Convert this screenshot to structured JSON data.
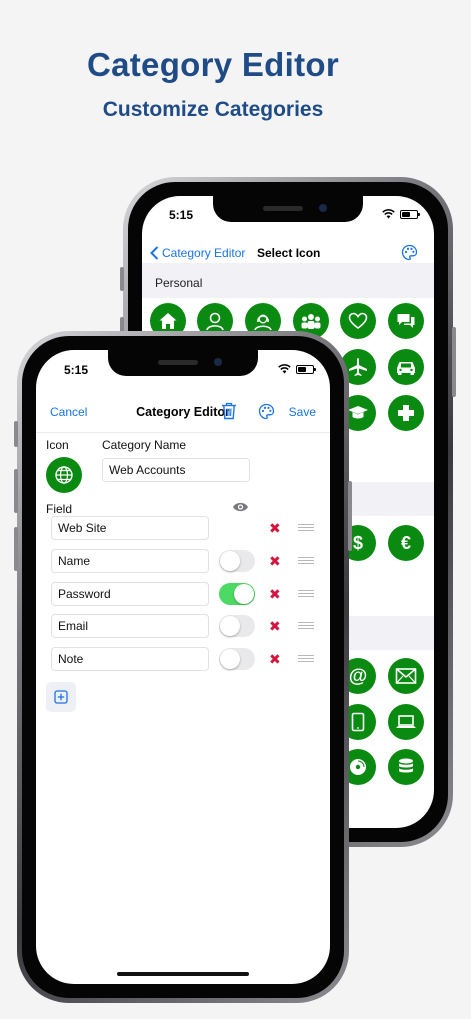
{
  "header": {
    "title": "Category Editor",
    "subtitle": "Customize Categories"
  },
  "back_screen": {
    "time": "5:15",
    "back_label": "Category Editor",
    "title": "Select Icon",
    "sections": [
      {
        "label": "Personal"
      }
    ],
    "icons": [
      "home-icon",
      "man-icon",
      "woman-icon",
      "group-icon",
      "heart-icon",
      "chat-icon",
      "plane-icon",
      "car-icon",
      "graduation-cap-icon",
      "plus-icon",
      "dollar-icon",
      "euro-icon",
      "email-at-icon",
      "envelope-icon",
      "tablet-icon",
      "laptop-icon",
      "disc-icon",
      "database-icon"
    ]
  },
  "front_screen": {
    "time": "5:15",
    "nav": {
      "cancel": "Cancel",
      "title": "Category Editor",
      "save": "Save"
    },
    "icon_label": "Icon",
    "category_name_label": "Category Name",
    "category_name_value": "Web Accounts",
    "field_label": "Field",
    "fields": [
      {
        "value": "Web Site",
        "has_toggle": false,
        "on": false
      },
      {
        "value": "Name",
        "has_toggle": true,
        "on": false
      },
      {
        "value": "Password",
        "has_toggle": true,
        "on": true
      },
      {
        "value": "Email",
        "has_toggle": true,
        "on": false
      },
      {
        "value": "Note",
        "has_toggle": true,
        "on": false
      }
    ],
    "delete_glyph": "✖"
  },
  "colors": {
    "brand": "#1f4b86",
    "accent": "#1a73e8",
    "icon_green": "#0b8a12",
    "delete_red": "#d0183f",
    "toggle_on": "#4cd964"
  }
}
